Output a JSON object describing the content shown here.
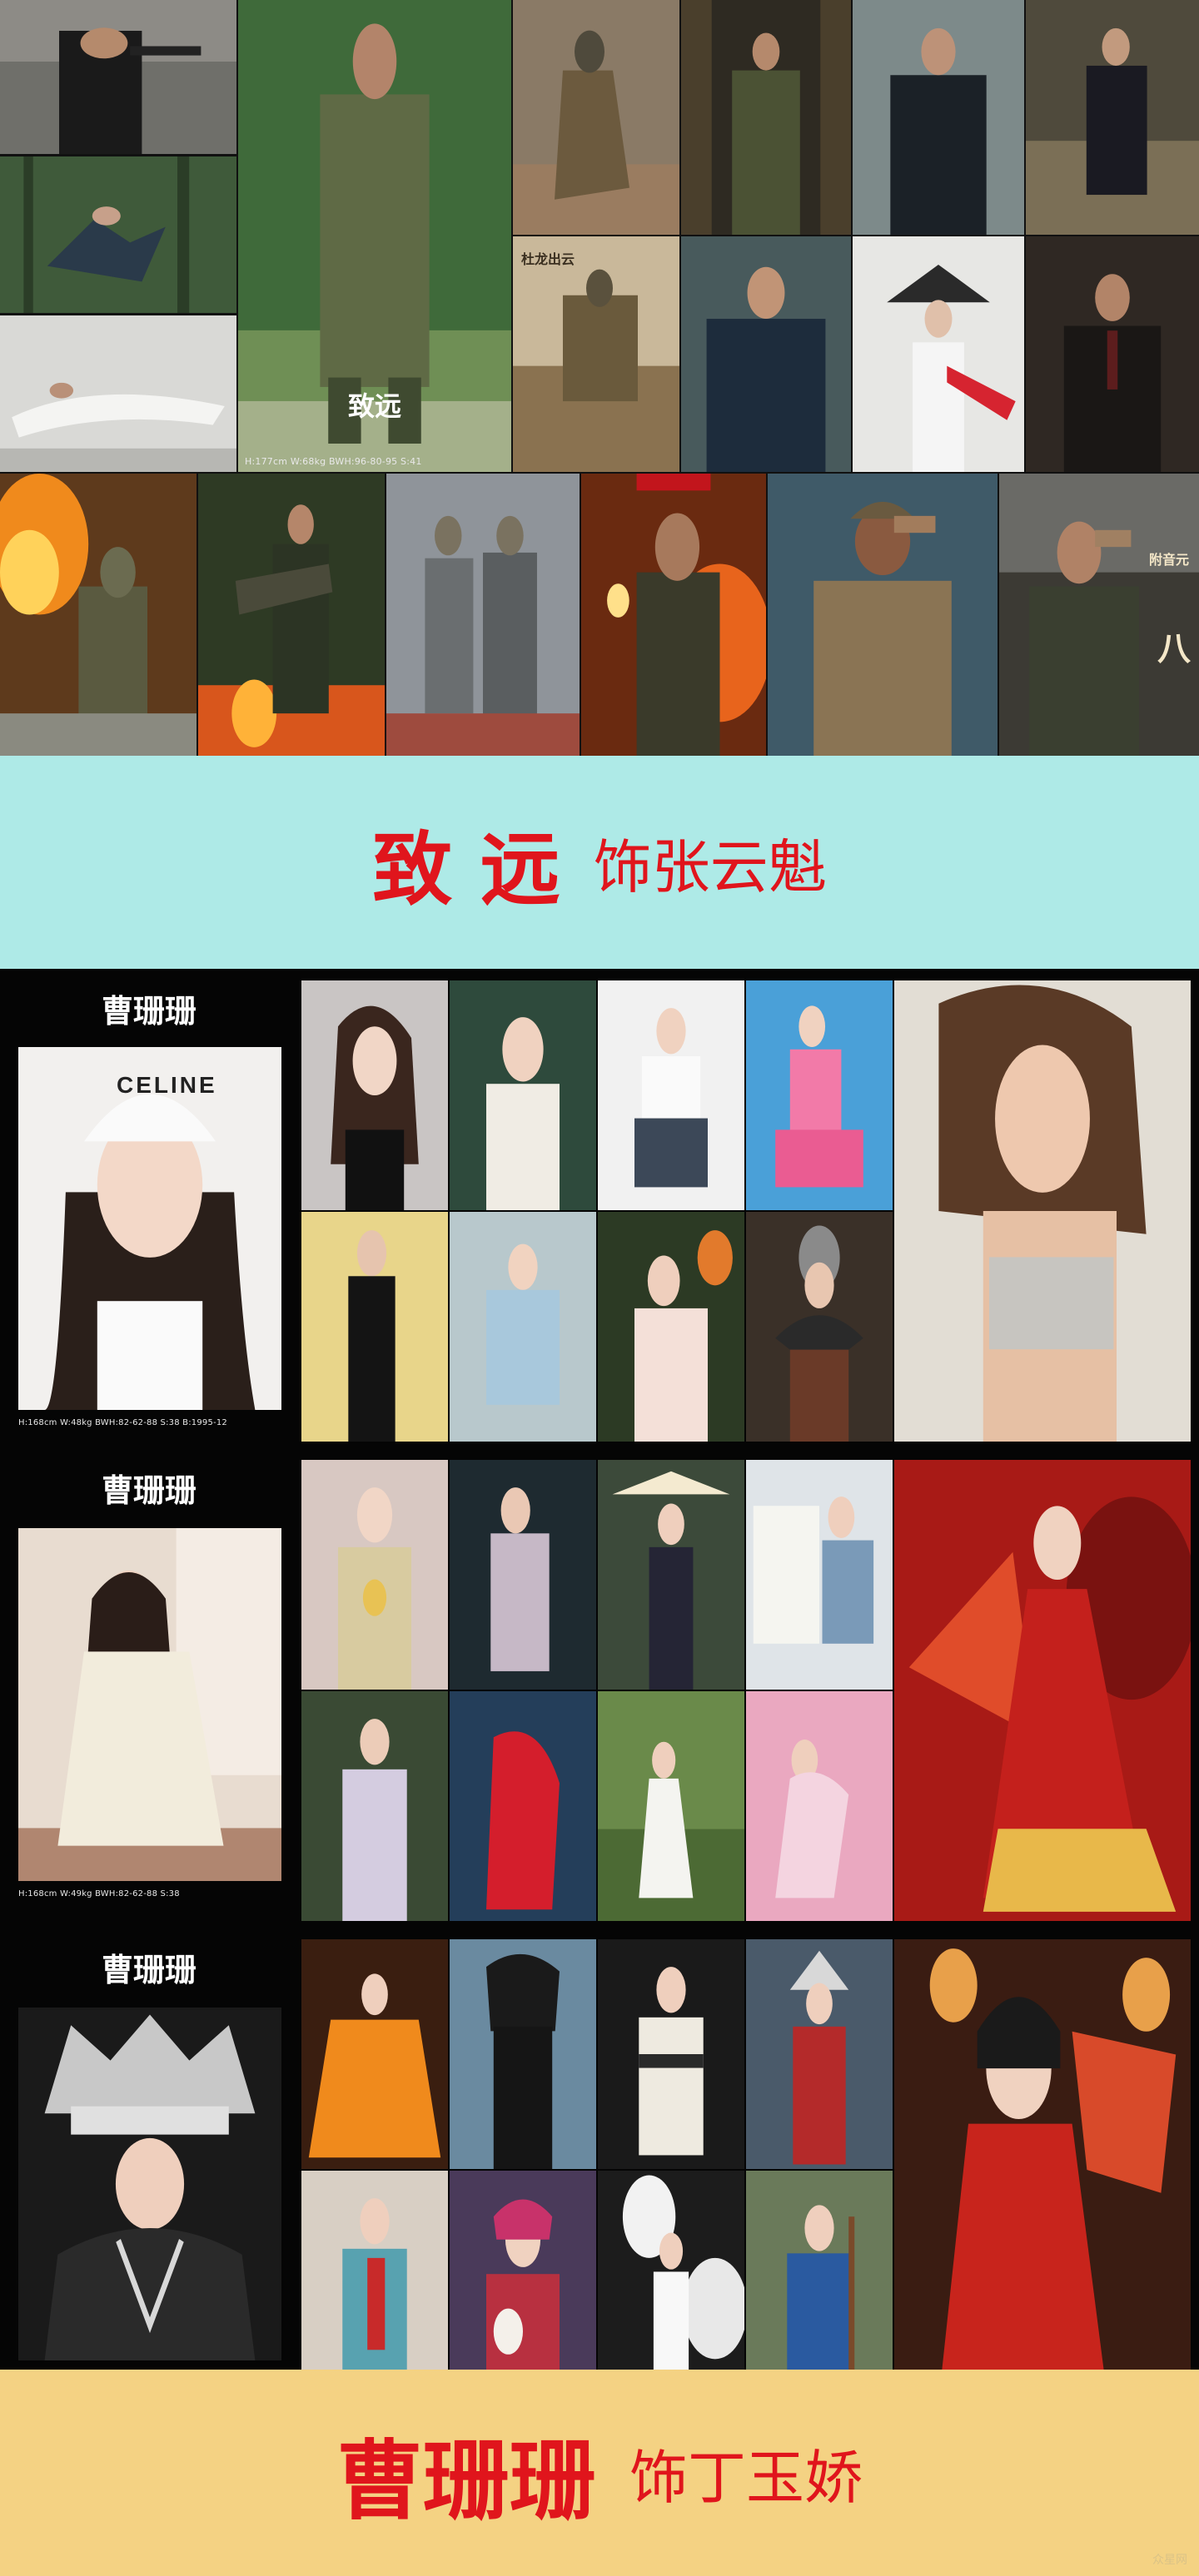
{
  "actor1": {
    "name": "致远",
    "stats": "H:177cm    W:68kg    BWH:96-80-95    S:41"
  },
  "banner1": {
    "actor": "致 远",
    "role": "饰张云魁",
    "bg": "#aeeae7",
    "color": "#e0151c"
  },
  "actress": {
    "name": "曹珊珊",
    "card1_stats": "H:168cm    W:48kg    BWH:82-62-88    S:38    B:1995-12",
    "card2_stats": "H:168cm    W:49kg    BWH:82-62-88    S:38",
    "cap_logo": "CELINE"
  },
  "banner2": {
    "actor": "曹珊珊",
    "role": "饰丁玉娇",
    "bg": "#f4d283",
    "color": "#e0151c"
  },
  "photo_texts": {
    "poster_a": "附音元",
    "poster_b": "八",
    "poster_c": "杜龙出云",
    "watermark": "众星网"
  }
}
